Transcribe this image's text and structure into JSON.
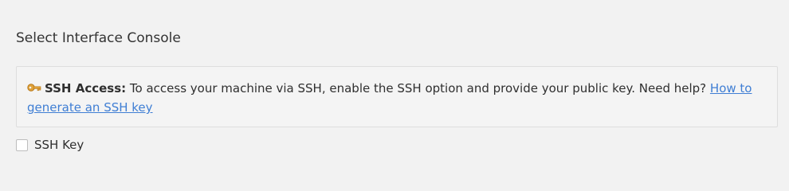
{
  "section": {
    "title": "Select Interface Console"
  },
  "notice": {
    "icon": "key-icon",
    "heading": "SSH Access:",
    "message": " To access your machine via SSH, enable the SSH option and provide your public key. Need help? ",
    "link_text": "How to generate an SSH key"
  },
  "options": {
    "ssh_key_label": "SSH Key",
    "ssh_key_checked": false
  },
  "colors": {
    "link": "#3f7ed4",
    "page_background": "#f2f2f2",
    "box_border": "#dedede"
  }
}
